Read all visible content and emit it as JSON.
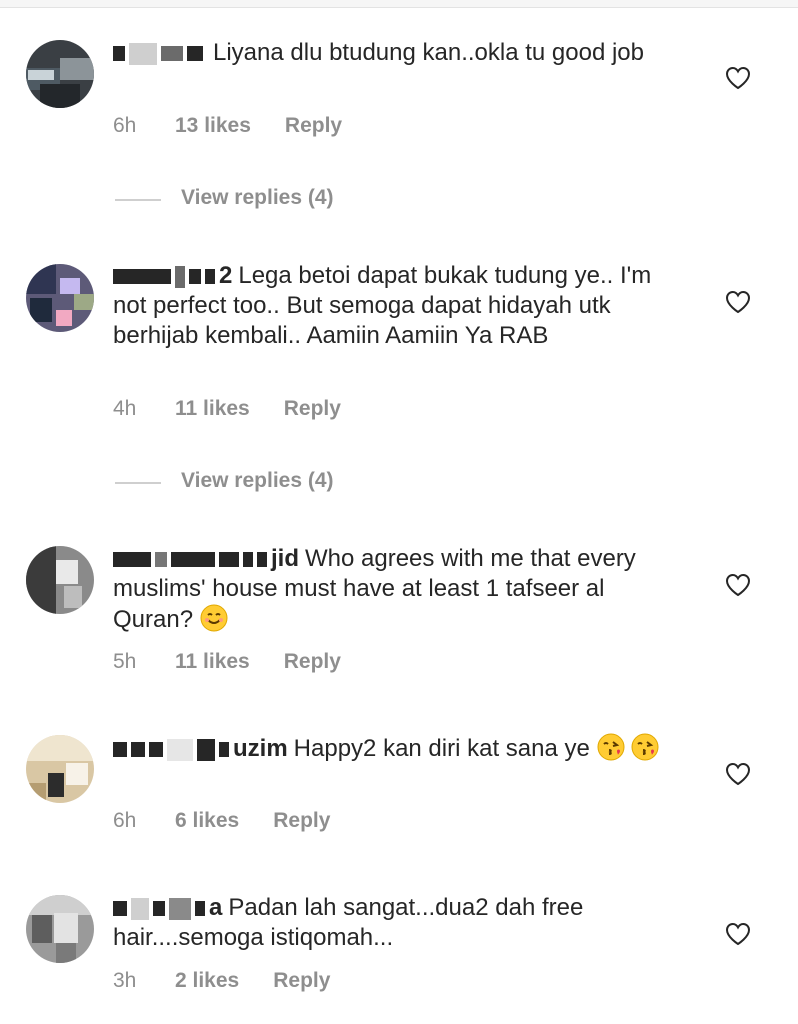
{
  "comments": [
    {
      "username_tail": "",
      "text": "Liyana dlu btudung kan..okla tu good job",
      "time": "6h",
      "likes": "13 likes",
      "reply": "Reply",
      "view_replies": "View replies (4)"
    },
    {
      "username_tail": "2",
      "text": "Lega betoi dapat bukak tudung ye.. I'm not perfect too.. But semoga dapat hidayah utk berhijab kembali.. Aamiin Aamiin Ya RAB",
      "time": "4h",
      "likes": "11 likes",
      "reply": "Reply",
      "view_replies": "View replies (4)"
    },
    {
      "username_tail": "jid",
      "text": "Who agrees with me that every muslims' house must have at least 1 tafseer al Quran?",
      "time": "5h",
      "likes": "11 likes",
      "reply": "Reply"
    },
    {
      "username_tail": "uzim",
      "text": "Happy2 kan diri kat sana ye",
      "time": "6h",
      "likes": "6 likes",
      "reply": "Reply"
    },
    {
      "username_tail": "a",
      "text": "Padan lah sangat...dua2 dah free hair....semoga istiqomah...",
      "time": "3h",
      "likes": "2 likes",
      "reply": "Reply"
    }
  ],
  "icons": {
    "like": "heart-outline-icon",
    "emoji_smile": "smiling-face-emoji",
    "emoji_kiss": "face-blowing-kiss-emoji"
  },
  "colors": {
    "text": "#262626",
    "meta": "#8e8e8e",
    "divider": "#cfcfcf"
  }
}
